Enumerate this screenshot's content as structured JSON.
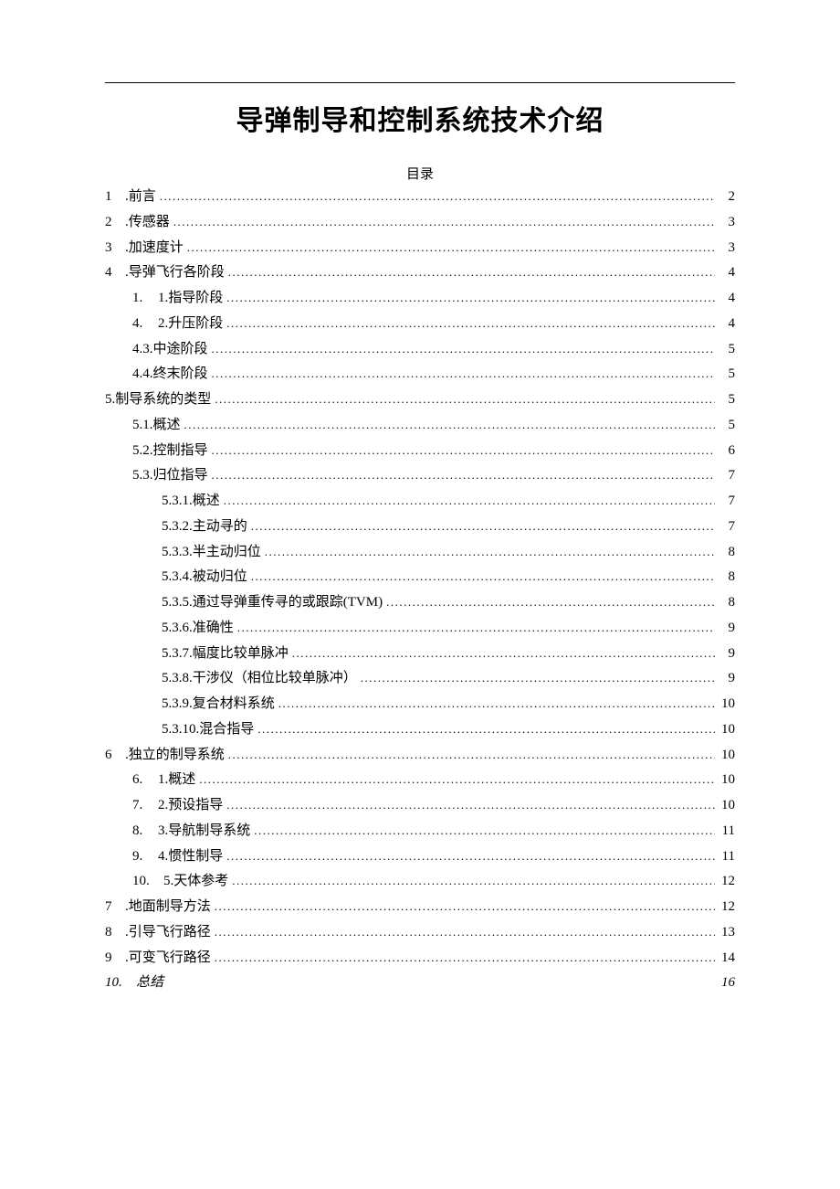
{
  "title": "导弹制导和控制系统技术介绍",
  "toc_heading": "目录",
  "entries": [
    {
      "indent": 0,
      "num": "1",
      "label": ".前言",
      "page": "2"
    },
    {
      "indent": 0,
      "num": "2",
      "label": ".传感器",
      "page": "3"
    },
    {
      "indent": 0,
      "num": "3",
      "label": ".加速度计",
      "page": "3"
    },
    {
      "indent": 0,
      "num": "4",
      "label": ".导弹飞行各阶段",
      "page": "4"
    },
    {
      "indent": 1,
      "num": "1.",
      "label": "1.指导阶段",
      "page": "4"
    },
    {
      "indent": 1,
      "num": "4.",
      "label": "2.升压阶段",
      "page": "4"
    },
    {
      "indent": 1,
      "num": "",
      "label": "4.3.中途阶段",
      "page": "5"
    },
    {
      "indent": 1,
      "num": "",
      "label": "4.4.终末阶段",
      "page": "5"
    },
    {
      "indent": 0,
      "num": "",
      "label": "5.制导系统的类型",
      "page": "5"
    },
    {
      "indent": 1,
      "num": "",
      "label": "5.1.概述",
      "page": "5"
    },
    {
      "indent": 1,
      "num": "",
      "label": "5.2.控制指导",
      "page": "6"
    },
    {
      "indent": 1,
      "num": "",
      "label": "5.3.归位指导",
      "page": "7"
    },
    {
      "indent": 2,
      "num": "",
      "label": "5.3.1.概述",
      "page": "7"
    },
    {
      "indent": 2,
      "num": "",
      "label": "5.3.2.主动寻的",
      "page": "7"
    },
    {
      "indent": 2,
      "num": "",
      "label": "5.3.3.半主动归位",
      "page": "8"
    },
    {
      "indent": 2,
      "num": "",
      "label": "5.3.4.被动归位",
      "page": "8"
    },
    {
      "indent": 2,
      "num": "",
      "label": "5.3.5.通过导弹重传寻的或跟踪(TVM)",
      "page": "8"
    },
    {
      "indent": 2,
      "num": "",
      "label": "5.3.6.准确性",
      "page": "9"
    },
    {
      "indent": 2,
      "num": "",
      "label": "5.3.7.幅度比较单脉冲",
      "page": "9"
    },
    {
      "indent": 2,
      "num": "",
      "label": "5.3.8.干涉仪（相位比较单脉冲）",
      "page": "9"
    },
    {
      "indent": 2,
      "num": "",
      "label": "5.3.9.复合材料系统",
      "page": "10"
    },
    {
      "indent": 2,
      "num": "",
      "label": "5.3.10.混合指导",
      "page": "10"
    },
    {
      "indent": 0,
      "num": "6",
      "label": ".独立的制导系统",
      "page": "10"
    },
    {
      "indent": 1,
      "num": "6.",
      "label": "1.概述",
      "page": "10"
    },
    {
      "indent": 1,
      "num": "7.",
      "label": "2.预设指导",
      "page": "10"
    },
    {
      "indent": 1,
      "num": "8.",
      "label": "3.导航制导系统",
      "page": "11"
    },
    {
      "indent": 1,
      "num": "9.",
      "label": "4.惯性制导",
      "page": "11"
    },
    {
      "indent": 1,
      "num": "10.",
      "label": "5.天体参考",
      "page": "12"
    },
    {
      "indent": 0,
      "num": "7",
      "label": ".地面制导方法",
      "page": "12"
    },
    {
      "indent": 0,
      "num": "8",
      "label": ".引导飞行路径",
      "page": "13"
    },
    {
      "indent": 0,
      "num": "9",
      "label": ".可变飞行路径",
      "page": "14"
    }
  ],
  "last_entry": {
    "num": "10.",
    "label": "总结",
    "page": "16"
  }
}
